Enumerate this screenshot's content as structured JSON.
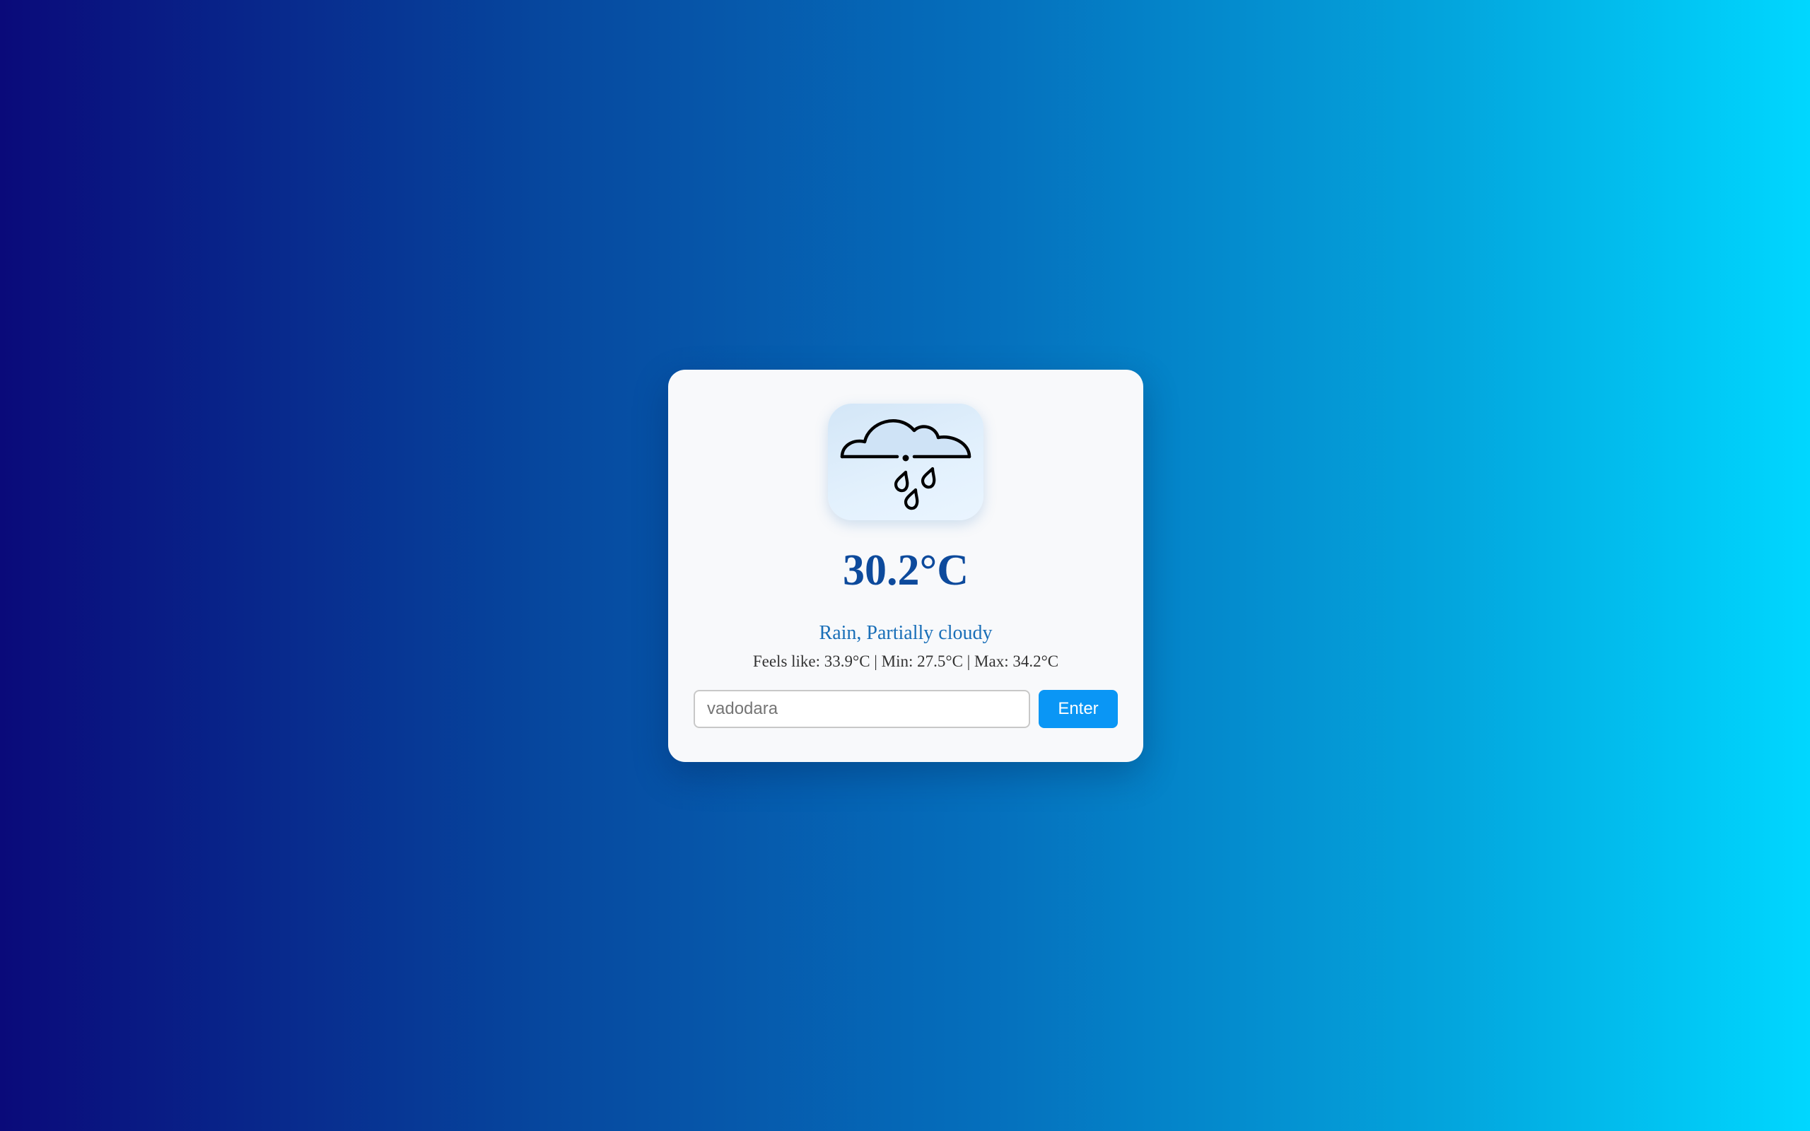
{
  "weather": {
    "icon": "rain-cloud-icon",
    "temperature": "30.2°C",
    "condition": "Rain, Partially cloudy",
    "details": "Feels like: 33.9°C | Min: 27.5°C | Max: 34.2°C"
  },
  "search": {
    "placeholder": "vadodara",
    "value": "",
    "button_label": "Enter"
  },
  "colors": {
    "background_start": "#0a0a7a",
    "background_end": "#00d7ff",
    "card": "#f8f9fb",
    "temperature": "#0d4a9c",
    "condition": "#1a6fb8",
    "button": "#0a96f5"
  }
}
